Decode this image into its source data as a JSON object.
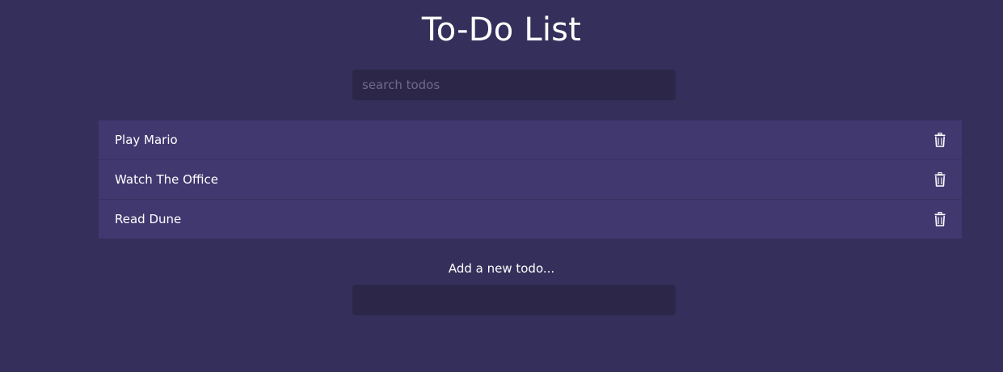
{
  "header": {
    "title": "To-Do List"
  },
  "search": {
    "placeholder": "search todos",
    "value": ""
  },
  "todos": [
    {
      "text": "Play Mario",
      "delete_icon": "trash-icon"
    },
    {
      "text": "Watch The Office",
      "delete_icon": "trash-icon"
    },
    {
      "text": "Read Dune",
      "delete_icon": "trash-icon"
    }
  ],
  "add_form": {
    "label": "Add a new todo...",
    "value": ""
  },
  "colors": {
    "background": "#352f5b",
    "item_background": "#423870",
    "input_background": "#2c2749",
    "text": "#ffffff"
  }
}
